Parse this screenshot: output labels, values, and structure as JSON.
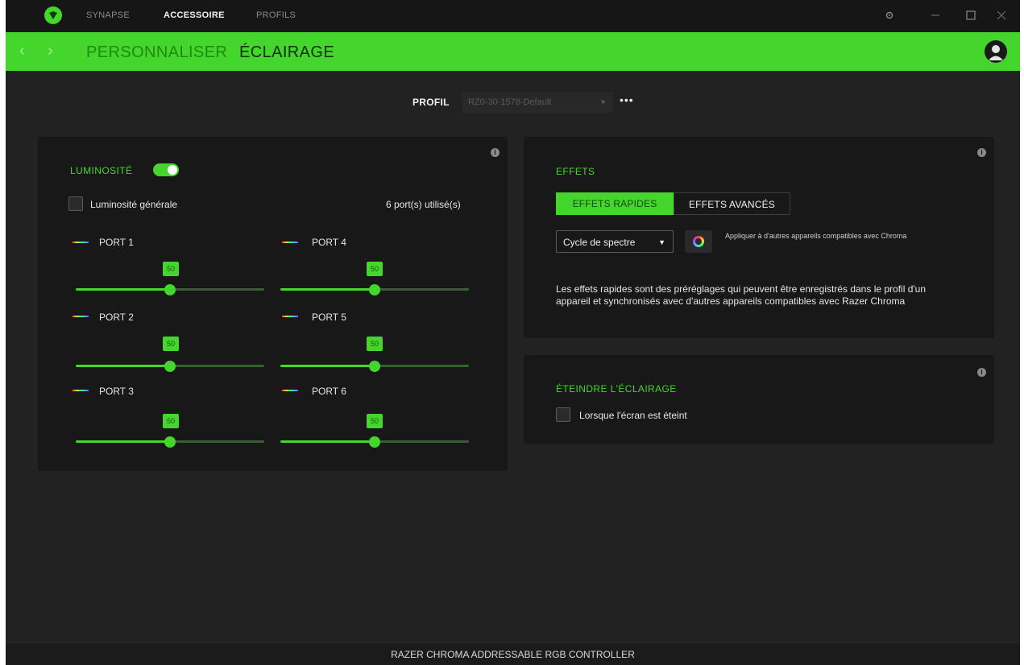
{
  "titlebar": {
    "tabs": [
      {
        "label": "SYNAPSE",
        "active": false
      },
      {
        "label": "ACCESSOIRE",
        "active": true
      },
      {
        "label": "PROFILS",
        "active": false
      }
    ],
    "icons": [
      "razer-logo-icon",
      "settings-icon",
      "minimize-icon",
      "maximize-icon",
      "close-icon"
    ]
  },
  "subnav": {
    "back": "‹",
    "forward": "›",
    "tabs": [
      {
        "label": "PERSONNALISER",
        "active": false
      },
      {
        "label": "ÉCLAIRAGE",
        "active": true
      }
    ]
  },
  "profile": {
    "label": "PROFIL",
    "value": "RZ0-30-1578-Default",
    "more": "•••"
  },
  "brightness": {
    "title": "LUMINOSITÉ",
    "toggle_on": true,
    "info": "i",
    "general_label": "Luminosité générale",
    "general_checked": false,
    "ports_used": "6 port(s) utilisé(s)",
    "ports": [
      {
        "name": "PORT 1",
        "value": 50
      },
      {
        "name": "PORT 2",
        "value": 50
      },
      {
        "name": "PORT 3",
        "value": 50
      },
      {
        "name": "PORT 4",
        "value": 50
      },
      {
        "name": "PORT 5",
        "value": 50
      },
      {
        "name": "PORT 6",
        "value": 50
      }
    ]
  },
  "effects": {
    "title": "EFFETS",
    "info": "i",
    "tab_quick": "EFFETS RAPIDES",
    "tab_advanced": "EFFETS AVANCÉS",
    "active_tab": "quick",
    "effect_value": "Cycle de spectre",
    "apply_text": "Appliquer à d'autres appareils compatibles avec Chroma",
    "description": "Les effets rapides sont des préréglages qui peuvent être enregistrés dans le profil d'un appareil et synchronisés avec d'autres appareils compatibles avec Razer Chroma"
  },
  "lights_off": {
    "title": "ÉTEINDRE L'ÉCLAIRAGE",
    "info": "i",
    "option_label": "Lorsque l'écran est éteint",
    "option_checked": false
  },
  "footer": {
    "device_name": "RAZER CHROMA ADDRESSABLE RGB CONTROLLER"
  },
  "colors": {
    "accent": "#44d62c",
    "background": "#222222",
    "panel": "#181818"
  }
}
